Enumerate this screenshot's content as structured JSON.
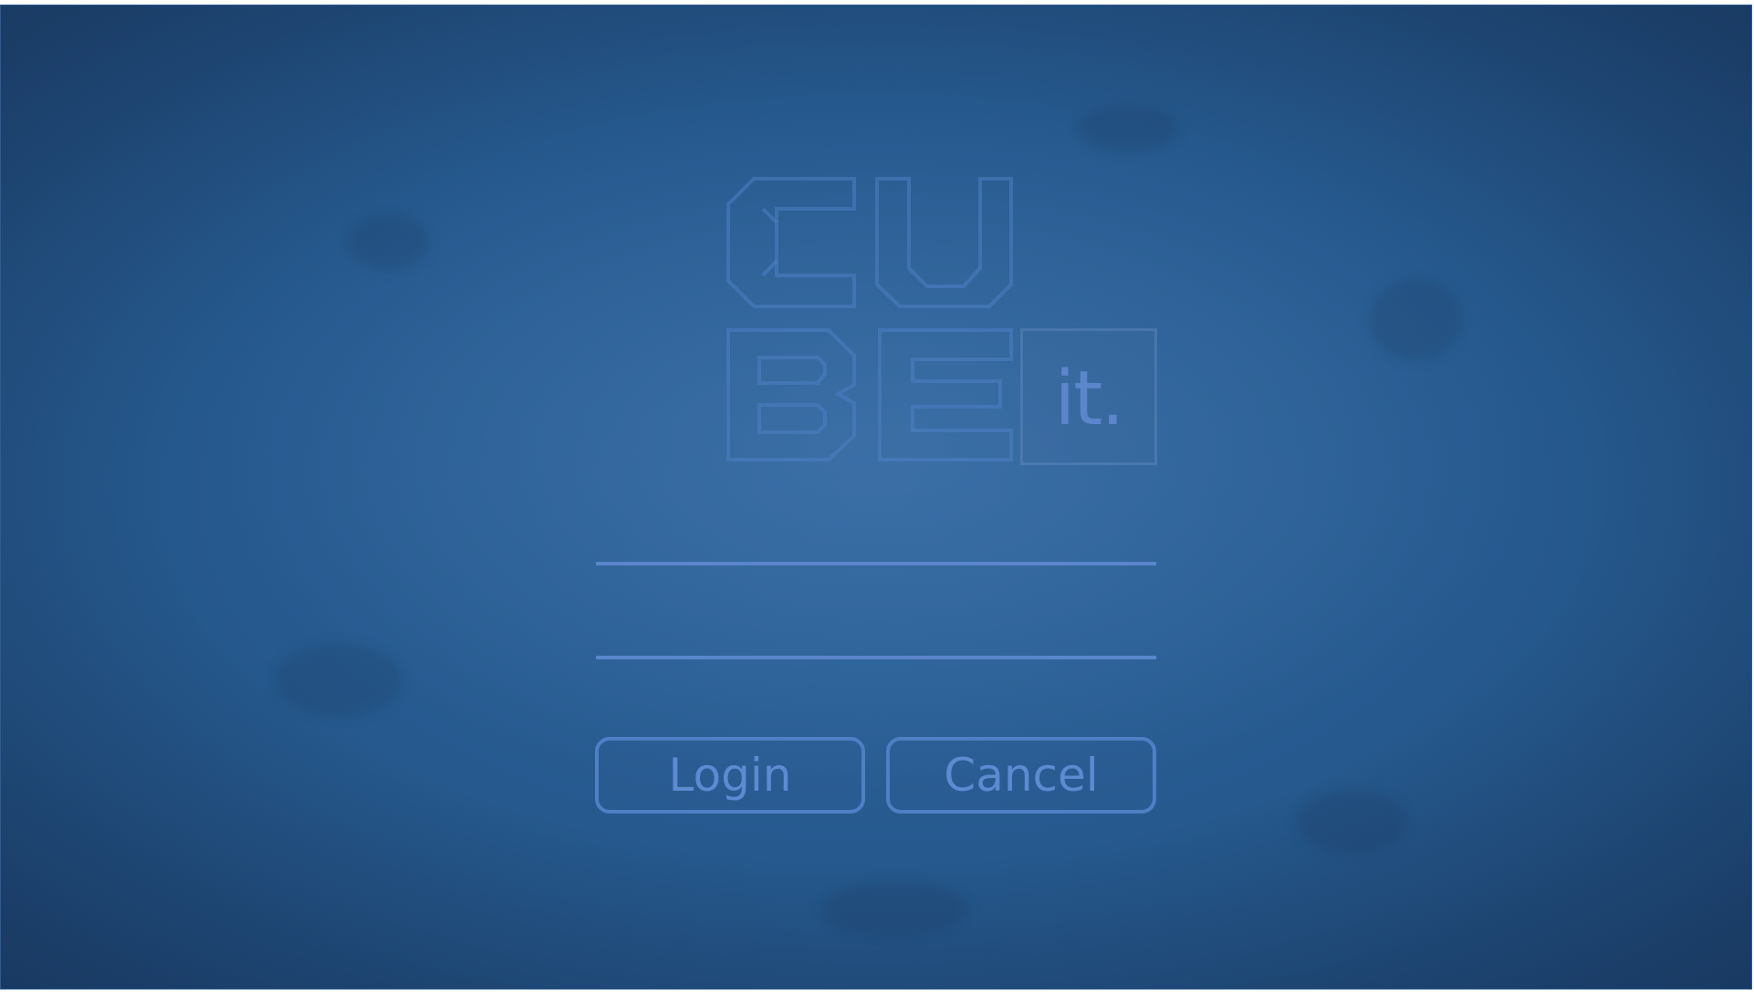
{
  "logo": {
    "letters": [
      "C",
      "U",
      "B",
      "E"
    ],
    "tag": "it."
  },
  "watermark": "",
  "form": {
    "username": {
      "value": "",
      "placeholder": ""
    },
    "password": {
      "value": "",
      "placeholder": ""
    }
  },
  "buttons": {
    "login_label": "Login",
    "cancel_label": "Cancel"
  },
  "colors": {
    "background": "#2a5f96",
    "accent": "#5a86cc"
  }
}
